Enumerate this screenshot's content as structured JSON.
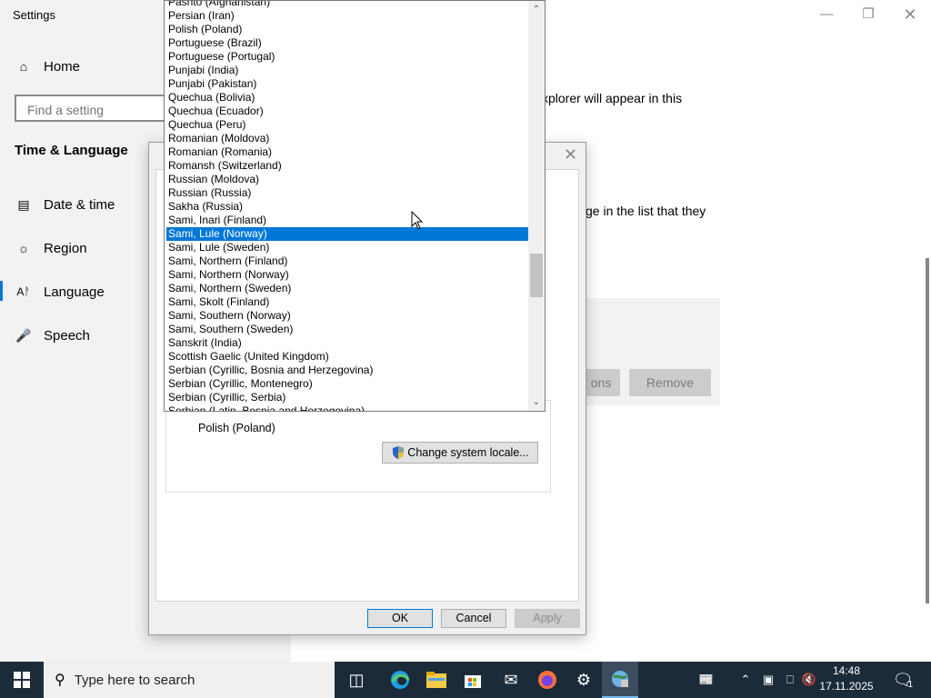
{
  "settings": {
    "title": "Settings",
    "nav": {
      "home": "Home",
      "search_placeholder": "Find a setting",
      "section": "Time & Language",
      "items": [
        "Date & time",
        "Region",
        "Language",
        "Speech"
      ]
    },
    "right": {
      "text1": "xplorer will appear in this",
      "text2": "ge in the list that they",
      "options_button": "ons",
      "remove_button": "Remove"
    }
  },
  "dialog": {
    "current_locale": "Polish (Poland)",
    "change_locale_button": "Change system locale...",
    "ok": "OK",
    "cancel": "Cancel",
    "apply": "Apply"
  },
  "dropdown": {
    "items": [
      "Pashto (Afghanistan)",
      "Persian (Iran)",
      "Polish (Poland)",
      "Portuguese (Brazil)",
      "Portuguese (Portugal)",
      "Punjabi (India)",
      "Punjabi (Pakistan)",
      "Quechua (Bolivia)",
      "Quechua (Ecuador)",
      "Quechua (Peru)",
      "Romanian (Moldova)",
      "Romanian (Romania)",
      "Romansh (Switzerland)",
      "Russian (Moldova)",
      "Russian (Russia)",
      "Sakha (Russia)",
      "Sami, Inari (Finland)",
      "Sami, Lule (Norway)",
      "Sami, Lule (Sweden)",
      "Sami, Northern (Finland)",
      "Sami, Northern (Norway)",
      "Sami, Northern (Sweden)",
      "Sami, Skolt (Finland)",
      "Sami, Southern (Norway)",
      "Sami, Southern (Sweden)",
      "Sanskrit (India)",
      "Scottish Gaelic (United Kingdom)",
      "Serbian (Cyrillic, Bosnia and Herzegovina)",
      "Serbian (Cyrillic, Montenegro)",
      "Serbian (Cyrillic, Serbia)",
      "Serbian (Latin, Bosnia and Herzegovina)"
    ],
    "selected": "Sami, Lule (Norway)"
  },
  "taskbar": {
    "search_placeholder": "Type here to search",
    "time": "14:48",
    "date": "17.11.2025",
    "notification_count": "1"
  },
  "colors": {
    "accent": "#0078d7",
    "taskbar": "#1c2b3a"
  }
}
